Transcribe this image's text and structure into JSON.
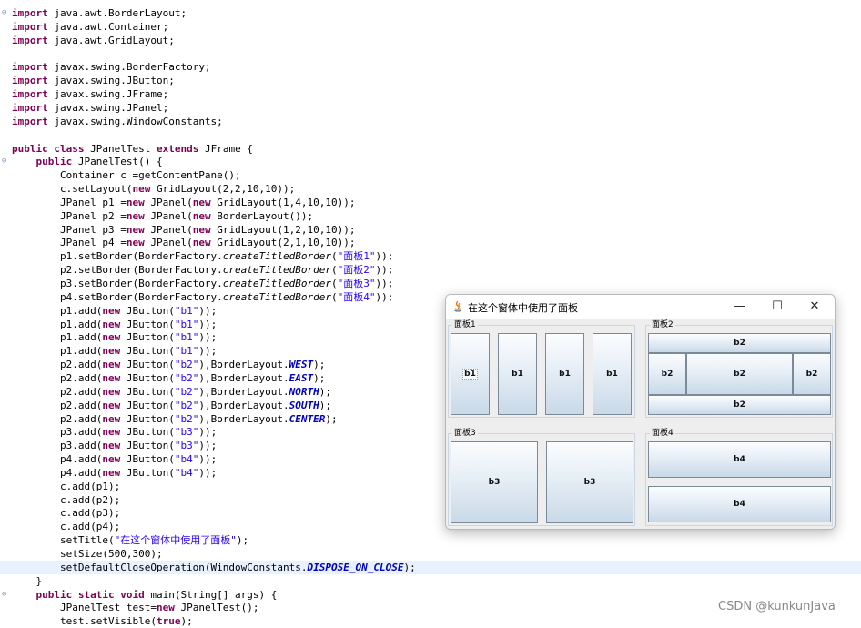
{
  "code": [
    {
      "fold": "minus",
      "parts": [
        {
          "c": "kw",
          "t": "import"
        },
        {
          "t": " java.awt.BorderLayout;"
        }
      ]
    },
    {
      "parts": [
        {
          "c": "kw",
          "t": "import"
        },
        {
          "t": " java.awt.Container;"
        }
      ]
    },
    {
      "parts": [
        {
          "c": "kw",
          "t": "import"
        },
        {
          "t": " java.awt.GridLayout;"
        }
      ]
    },
    {
      "parts": []
    },
    {
      "parts": [
        {
          "c": "kw",
          "t": "import"
        },
        {
          "t": " javax.swing.BorderFactory;"
        }
      ]
    },
    {
      "parts": [
        {
          "c": "kw",
          "t": "import"
        },
        {
          "t": " javax.swing.JButton;"
        }
      ]
    },
    {
      "parts": [
        {
          "c": "kw",
          "t": "import"
        },
        {
          "t": " javax.swing.JFrame;"
        }
      ]
    },
    {
      "parts": [
        {
          "c": "kw",
          "t": "import"
        },
        {
          "t": " javax.swing.JPanel;"
        }
      ]
    },
    {
      "parts": [
        {
          "c": "kw",
          "t": "import"
        },
        {
          "t": " javax.swing.WindowConstants;"
        }
      ]
    },
    {
      "parts": []
    },
    {
      "parts": [
        {
          "c": "kw",
          "t": "public class"
        },
        {
          "t": " JPanelTest "
        },
        {
          "c": "kw",
          "t": "extends"
        },
        {
          "t": " JFrame {"
        }
      ]
    },
    {
      "fold": "minus",
      "parts": [
        {
          "t": "    "
        },
        {
          "c": "kw",
          "t": "public"
        },
        {
          "t": " JPanelTest() {"
        }
      ]
    },
    {
      "parts": [
        {
          "t": "        Container c =getContentPane();"
        }
      ]
    },
    {
      "parts": [
        {
          "t": "        c.setLayout("
        },
        {
          "c": "kw",
          "t": "new"
        },
        {
          "t": " GridLayout(2,2,10,10));"
        }
      ]
    },
    {
      "parts": [
        {
          "t": "        JPanel p1 ="
        },
        {
          "c": "kw",
          "t": "new"
        },
        {
          "t": " JPanel("
        },
        {
          "c": "kw",
          "t": "new"
        },
        {
          "t": " GridLayout(1,4,10,10));"
        }
      ]
    },
    {
      "parts": [
        {
          "t": "        JPanel p2 ="
        },
        {
          "c": "kw",
          "t": "new"
        },
        {
          "t": " JPanel("
        },
        {
          "c": "kw",
          "t": "new"
        },
        {
          "t": " BorderLayout());"
        }
      ]
    },
    {
      "parts": [
        {
          "t": "        JPanel p3 ="
        },
        {
          "c": "kw",
          "t": "new"
        },
        {
          "t": " JPanel("
        },
        {
          "c": "kw",
          "t": "new"
        },
        {
          "t": " GridLayout(1,2,10,10));"
        }
      ]
    },
    {
      "parts": [
        {
          "t": "        JPanel p4 ="
        },
        {
          "c": "kw",
          "t": "new"
        },
        {
          "t": " JPanel("
        },
        {
          "c": "kw",
          "t": "new"
        },
        {
          "t": " GridLayout(2,1,10,10));"
        }
      ]
    },
    {
      "parts": [
        {
          "t": "        p1.setBorder(BorderFactory."
        },
        {
          "c": "it",
          "t": "createTitledBorder"
        },
        {
          "t": "("
        },
        {
          "c": "str",
          "t": "\"面板1\""
        },
        {
          "t": "));"
        }
      ]
    },
    {
      "parts": [
        {
          "t": "        p2.setBorder(BorderFactory."
        },
        {
          "c": "it",
          "t": "createTitledBorder"
        },
        {
          "t": "("
        },
        {
          "c": "str",
          "t": "\"面板2\""
        },
        {
          "t": "));"
        }
      ]
    },
    {
      "parts": [
        {
          "t": "        p3.setBorder(BorderFactory."
        },
        {
          "c": "it",
          "t": "createTitledBorder"
        },
        {
          "t": "("
        },
        {
          "c": "str",
          "t": "\"面板3\""
        },
        {
          "t": "));"
        }
      ]
    },
    {
      "parts": [
        {
          "t": "        p4.setBorder(BorderFactory."
        },
        {
          "c": "it",
          "t": "createTitledBorder"
        },
        {
          "t": "("
        },
        {
          "c": "str",
          "t": "\"面板4\""
        },
        {
          "t": "));"
        }
      ]
    },
    {
      "parts": [
        {
          "t": "        p1.add("
        },
        {
          "c": "kw",
          "t": "new"
        },
        {
          "t": " JButton("
        },
        {
          "c": "str",
          "t": "\"b1\""
        },
        {
          "t": "));"
        }
      ]
    },
    {
      "parts": [
        {
          "t": "        p1.add("
        },
        {
          "c": "kw",
          "t": "new"
        },
        {
          "t": " JButton("
        },
        {
          "c": "str",
          "t": "\"b1\""
        },
        {
          "t": "));"
        }
      ]
    },
    {
      "parts": [
        {
          "t": "        p1.add("
        },
        {
          "c": "kw",
          "t": "new"
        },
        {
          "t": " JButton("
        },
        {
          "c": "str",
          "t": "\"b1\""
        },
        {
          "t": "));"
        }
      ]
    },
    {
      "parts": [
        {
          "t": "        p1.add("
        },
        {
          "c": "kw",
          "t": "new"
        },
        {
          "t": " JButton("
        },
        {
          "c": "str",
          "t": "\"b1\""
        },
        {
          "t": "));"
        }
      ]
    },
    {
      "parts": [
        {
          "t": "        p2.add("
        },
        {
          "c": "kw",
          "t": "new"
        },
        {
          "t": " JButton("
        },
        {
          "c": "str",
          "t": "\"b2\""
        },
        {
          "t": "),BorderLayout."
        },
        {
          "c": "cst",
          "t": "WEST"
        },
        {
          "t": ");"
        }
      ]
    },
    {
      "parts": [
        {
          "t": "        p2.add("
        },
        {
          "c": "kw",
          "t": "new"
        },
        {
          "t": " JButton("
        },
        {
          "c": "str",
          "t": "\"b2\""
        },
        {
          "t": "),BorderLayout."
        },
        {
          "c": "cst",
          "t": "EAST"
        },
        {
          "t": ");"
        }
      ]
    },
    {
      "parts": [
        {
          "t": "        p2.add("
        },
        {
          "c": "kw",
          "t": "new"
        },
        {
          "t": " JButton("
        },
        {
          "c": "str",
          "t": "\"b2\""
        },
        {
          "t": "),BorderLayout."
        },
        {
          "c": "cst",
          "t": "NORTH"
        },
        {
          "t": ");"
        }
      ]
    },
    {
      "parts": [
        {
          "t": "        p2.add("
        },
        {
          "c": "kw",
          "t": "new"
        },
        {
          "t": " JButton("
        },
        {
          "c": "str",
          "t": "\"b2\""
        },
        {
          "t": "),BorderLayout."
        },
        {
          "c": "cst",
          "t": "SOUTH"
        },
        {
          "t": ");"
        }
      ]
    },
    {
      "parts": [
        {
          "t": "        p2.add("
        },
        {
          "c": "kw",
          "t": "new"
        },
        {
          "t": " JButton("
        },
        {
          "c": "str",
          "t": "\"b2\""
        },
        {
          "t": "),BorderLayout."
        },
        {
          "c": "cst",
          "t": "CENTER"
        },
        {
          "t": ");"
        }
      ]
    },
    {
      "parts": [
        {
          "t": "        p3.add("
        },
        {
          "c": "kw",
          "t": "new"
        },
        {
          "t": " JButton("
        },
        {
          "c": "str",
          "t": "\"b3\""
        },
        {
          "t": "));"
        }
      ]
    },
    {
      "parts": [
        {
          "t": "        p3.add("
        },
        {
          "c": "kw",
          "t": "new"
        },
        {
          "t": " JButton("
        },
        {
          "c": "str",
          "t": "\"b3\""
        },
        {
          "t": "));"
        }
      ]
    },
    {
      "parts": [
        {
          "t": "        p4.add("
        },
        {
          "c": "kw",
          "t": "new"
        },
        {
          "t": " JButton("
        },
        {
          "c": "str",
          "t": "\"b4\""
        },
        {
          "t": "));"
        }
      ]
    },
    {
      "parts": [
        {
          "t": "        p4.add("
        },
        {
          "c": "kw",
          "t": "new"
        },
        {
          "t": " JButton("
        },
        {
          "c": "str",
          "t": "\"b4\""
        },
        {
          "t": "));"
        }
      ]
    },
    {
      "parts": [
        {
          "t": "        c.add(p1);"
        }
      ]
    },
    {
      "parts": [
        {
          "t": "        c.add(p2);"
        }
      ]
    },
    {
      "parts": [
        {
          "t": "        c.add(p3);"
        }
      ]
    },
    {
      "parts": [
        {
          "t": "        c.add(p4);"
        }
      ]
    },
    {
      "parts": [
        {
          "t": "        setTitle("
        },
        {
          "c": "str",
          "t": "\"在这个窗体中使用了面板\""
        },
        {
          "t": ");"
        }
      ]
    },
    {
      "parts": [
        {
          "t": "        setSize(500,300);"
        }
      ]
    },
    {
      "highlight": true,
      "parts": [
        {
          "t": "        setDefaultCloseOperation(WindowConstants."
        },
        {
          "c": "cst",
          "t": "DISPOSE_ON_CLOSE"
        },
        {
          "t": ");"
        }
      ]
    },
    {
      "parts": [
        {
          "t": "    }"
        }
      ]
    },
    {
      "fold": "minus",
      "parts": [
        {
          "t": "    "
        },
        {
          "c": "kw",
          "t": "public static void"
        },
        {
          "t": " main(String[] args) {"
        }
      ]
    },
    {
      "parts": [
        {
          "t": "        JPanelTest test="
        },
        {
          "c": "kw",
          "t": "new"
        },
        {
          "t": " JPanelTest();"
        }
      ]
    },
    {
      "parts": [
        {
          "t": "        test.setVisible("
        },
        {
          "c": "kw",
          "t": "true"
        },
        {
          "t": ");"
        }
      ]
    }
  ],
  "window": {
    "title": "在这个窗体中使用了面板",
    "controls": {
      "minimize": "—",
      "maximize": "☐",
      "close": "✕"
    },
    "panels": {
      "p1": {
        "title": "面板1",
        "buttons": [
          "b1",
          "b1",
          "b1",
          "b1"
        ]
      },
      "p2": {
        "title": "面板2",
        "north": "b2",
        "west": "b2",
        "center": "b2",
        "east": "b2",
        "south": "b2"
      },
      "p3": {
        "title": "面板3",
        "buttons": [
          "b3",
          "b3"
        ]
      },
      "p4": {
        "title": "面板4",
        "buttons": [
          "b4",
          "b4"
        ]
      }
    }
  },
  "watermark": "CSDN @kunkunJava"
}
